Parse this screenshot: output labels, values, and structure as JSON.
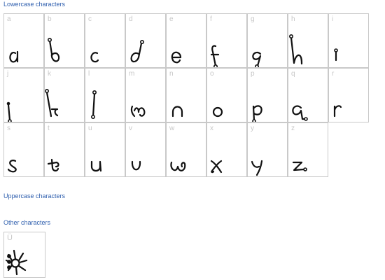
{
  "sections": {
    "lowercase_title": "Lowercase characters",
    "uppercase_title": "Uppercase characters",
    "other_title": "Other characters"
  },
  "lowercase": [
    {
      "label": "a",
      "glyph": "a-glyph-icon"
    },
    {
      "label": "b",
      "glyph": "b-glyph-icon"
    },
    {
      "label": "c",
      "glyph": "c-glyph-icon"
    },
    {
      "label": "d",
      "glyph": "d-glyph-icon"
    },
    {
      "label": "e",
      "glyph": "e-glyph-icon"
    },
    {
      "label": "f",
      "glyph": "f-glyph-icon"
    },
    {
      "label": "g",
      "glyph": "g-glyph-icon"
    },
    {
      "label": "h",
      "glyph": "h-glyph-icon"
    },
    {
      "label": "i",
      "glyph": "i-glyph-icon"
    },
    {
      "label": "j",
      "glyph": "j-glyph-icon"
    },
    {
      "label": "k",
      "glyph": "k-glyph-icon"
    },
    {
      "label": "l",
      "glyph": "l-glyph-icon"
    },
    {
      "label": "m",
      "glyph": "m-glyph-icon"
    },
    {
      "label": "n",
      "glyph": "n-glyph-icon"
    },
    {
      "label": "o",
      "glyph": "o-glyph-icon"
    },
    {
      "label": "p",
      "glyph": "p-glyph-icon"
    },
    {
      "label": "q",
      "glyph": "q-glyph-icon"
    },
    {
      "label": "r",
      "glyph": "r-glyph-icon"
    },
    {
      "label": "s",
      "glyph": "s-glyph-icon"
    },
    {
      "label": "t",
      "glyph": "t-glyph-icon"
    },
    {
      "label": "u",
      "glyph": "u-glyph-icon"
    },
    {
      "label": "v",
      "glyph": "v-glyph-icon"
    },
    {
      "label": "w",
      "glyph": "w-glyph-icon"
    },
    {
      "label": "x",
      "glyph": "x-glyph-icon"
    },
    {
      "label": "y",
      "glyph": "y-glyph-icon"
    },
    {
      "label": "z",
      "glyph": "z-glyph-icon"
    }
  ],
  "other": [
    {
      "label": "Ü",
      "glyph": "spider-glyph-icon"
    }
  ],
  "colors": {
    "section_title": "#2f5fae",
    "cell_border": "#c9c9c9",
    "cell_label": "#c7c7c7",
    "glyph_ink": "#111111"
  }
}
